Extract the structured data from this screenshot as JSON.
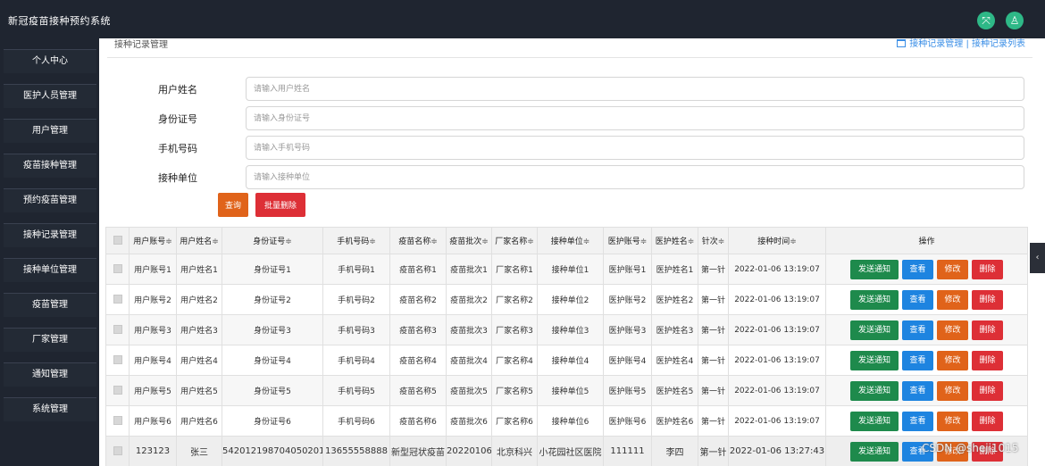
{
  "header": {
    "app_title": "新冠疫苗接种预约系统",
    "icons": [
      "expand-icon",
      "user-icon"
    ],
    "accent_color": "#2eb887"
  },
  "sidebar": {
    "items": [
      {
        "label": "个人中心"
      },
      {
        "label": "医护人员管理"
      },
      {
        "label": "用户管理"
      },
      {
        "label": "疫苗接种管理"
      },
      {
        "label": "预约疫苗管理"
      },
      {
        "label": "接种记录管理"
      },
      {
        "label": "接种单位管理"
      },
      {
        "label": "疫苗管理"
      },
      {
        "label": "厂家管理"
      },
      {
        "label": "通知管理"
      },
      {
        "label": "系统管理"
      }
    ]
  },
  "breadcrumb": {
    "page_title": "接种记录管理",
    "path": "接种记录管理 | 接种记录列表"
  },
  "form": {
    "fields": [
      {
        "label": "用户姓名",
        "placeholder": "请输入用户姓名"
      },
      {
        "label": "身份证号",
        "placeholder": "请输入身份证号"
      },
      {
        "label": "手机号码",
        "placeholder": "请输入手机号码"
      },
      {
        "label": "接种单位",
        "placeholder": "请输入接种单位"
      }
    ],
    "query_label": "查询",
    "batch_delete_label": "批量删除"
  },
  "table": {
    "columns": [
      "用户账号",
      "用户姓名",
      "身份证号",
      "手机号码",
      "疫苗名称",
      "疫苗批次",
      "厂家名称",
      "接种单位",
      "医护账号",
      "医护姓名",
      "针次",
      "接种时间"
    ],
    "sortable_columns": [
      true,
      true,
      true,
      true,
      true,
      true,
      true,
      true,
      true,
      true,
      true,
      true
    ],
    "sort_marker": "≑",
    "actions_header": "操作",
    "actions": {
      "notify": "发送通知",
      "view": "查看",
      "edit": "修改",
      "delete": "删除"
    },
    "rows": [
      [
        "用户账号1",
        "用户姓名1",
        "身份证号1",
        "手机号码1",
        "疫苗名称1",
        "疫苗批次1",
        "厂家名称1",
        "接种单位1",
        "医护账号1",
        "医护姓名1",
        "第一针",
        "2022-01-06 13:19:07"
      ],
      [
        "用户账号2",
        "用户姓名2",
        "身份证号2",
        "手机号码2",
        "疫苗名称2",
        "疫苗批次2",
        "厂家名称2",
        "接种单位2",
        "医护账号2",
        "医护姓名2",
        "第一针",
        "2022-01-06 13:19:07"
      ],
      [
        "用户账号3",
        "用户姓名3",
        "身份证号3",
        "手机号码3",
        "疫苗名称3",
        "疫苗批次3",
        "厂家名称3",
        "接种单位3",
        "医护账号3",
        "医护姓名3",
        "第一针",
        "2022-01-06 13:19:07"
      ],
      [
        "用户账号4",
        "用户姓名4",
        "身份证号4",
        "手机号码4",
        "疫苗名称4",
        "疫苗批次4",
        "厂家名称4",
        "接种单位4",
        "医护账号4",
        "医护姓名4",
        "第一针",
        "2022-01-06 13:19:07"
      ],
      [
        "用户账号5",
        "用户姓名5",
        "身份证号5",
        "手机号码5",
        "疫苗名称5",
        "疫苗批次5",
        "厂家名称5",
        "接种单位5",
        "医护账号5",
        "医护姓名5",
        "第一针",
        "2022-01-06 13:19:07"
      ],
      [
        "用户账号6",
        "用户姓名6",
        "身份证号6",
        "手机号码6",
        "疫苗名称6",
        "疫苗批次6",
        "厂家名称6",
        "接种单位6",
        "医护账号6",
        "医护姓名6",
        "第一针",
        "2022-01-06 13:19:07"
      ],
      [
        "123123",
        "张三",
        "542012198704050201",
        "13655558888",
        "新型冠状疫苗",
        "20220106",
        "北京科兴",
        "小花园社区医院",
        "111111",
        "李四",
        "第一针",
        "2022-01-06 13:27:43"
      ]
    ]
  },
  "edge_tab": {
    "glyph": "‹"
  },
  "watermark": "CSDN @sheji1015"
}
